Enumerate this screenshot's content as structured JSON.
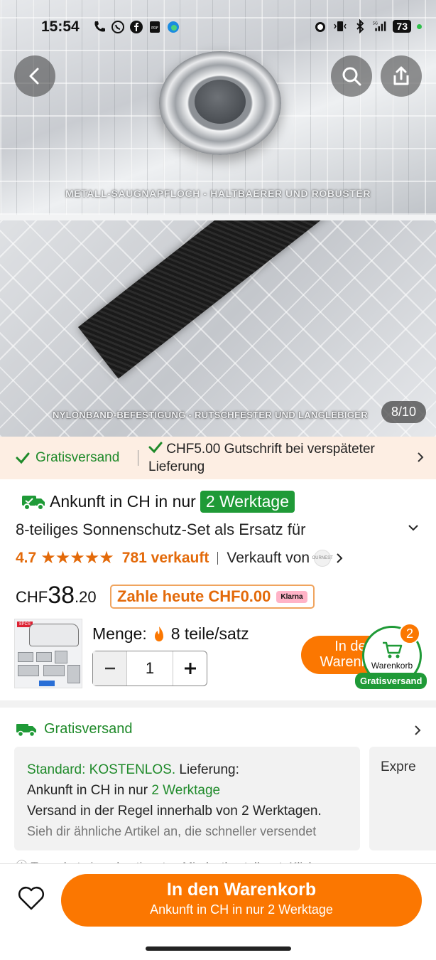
{
  "status_bar": {
    "time": "15:54",
    "battery": "73",
    "network": "5G"
  },
  "gallery": {
    "caption_1": "METALL-SAUGNAPFLOCH - HALTBAERER UND ROBUSTER",
    "caption_2": "NYLONBAND-BEFESTIGUNG - RUTSCHFESTER UND LANGLEBIGER",
    "counter": "8/10"
  },
  "promo": {
    "item_1": "Gratisversand",
    "item_2": "CHF5.00 Gutschrift bei verspäteter Lieferung"
  },
  "product": {
    "arrival_prefix": "Ankunft in CH in nur",
    "arrival_badge": "2 Werktage",
    "title": "8-teiliges Sonnenschutz-Set als Ersatz für",
    "rating": "4.7",
    "stars": "★★★★★",
    "sold": "781 verkauft",
    "sold_by": "Verkauft von",
    "seller_logo_text": "OURNEST",
    "price_currency": "CHF",
    "price_main": "38",
    "price_decimal": ".20",
    "pay_today": "Zahle heute CHF0.00",
    "klarna": "Klarna",
    "quantity_label": "Menge:",
    "quantity_variant": "8 teile/satz",
    "quantity_value": "1",
    "thumb_badge": "8PCS",
    "add_small": "In den Warenkorb",
    "cart_label": "Warenkorb",
    "cart_count": "2",
    "free_badge": "Gratisversand"
  },
  "shipping": {
    "heading": "Gratisversand",
    "standard_label": "Standard: KOSTENLOS.",
    "delivery_label": "Lieferung:",
    "arrival_prefix": "Ankunft in CH in nur",
    "arrival_days": "2 Werktage",
    "usual": "Versand in der Regel innerhalb von 2 Werktagen.",
    "similar": "Sieh dir ähnliche Artikel an, die schneller versendet",
    "express": "Expre",
    "min_order": "Temu hat einen bestimmten Mindestbestellwert. Klicke"
  },
  "bottom": {
    "add_to_cart": "In den Warenkorb",
    "arrival": "Ankunft in CH in nur 2 Werktage"
  },
  "colors": {
    "orange": "#fb7701",
    "green": "#1f9a37",
    "promo_bg": "#fdeee3"
  }
}
